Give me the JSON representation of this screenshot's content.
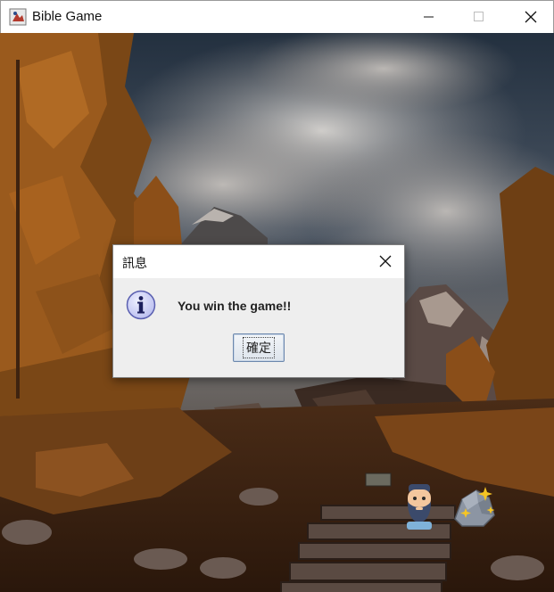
{
  "window": {
    "title": "Bible Game",
    "app_icon": "java-app-icon",
    "controls": [
      "minimize-icon",
      "maximize-icon",
      "close-icon"
    ]
  },
  "dialog": {
    "title": "訊息",
    "message": "You win the game!!",
    "ok_label": "確定",
    "icon": "info-icon"
  },
  "scene": {
    "background": "autumn forest mountain trail",
    "player_sprite": "bearded-man-icon",
    "item_sprite": "sparkling-stone-icon"
  },
  "colors": {
    "titlebar": "#ffffff",
    "dialog_bg": "#eeeeee",
    "info_icon_fill": "#c8cbf2",
    "info_icon_stroke": "#5a5fb0",
    "ok_border": "#6b87ad"
  }
}
